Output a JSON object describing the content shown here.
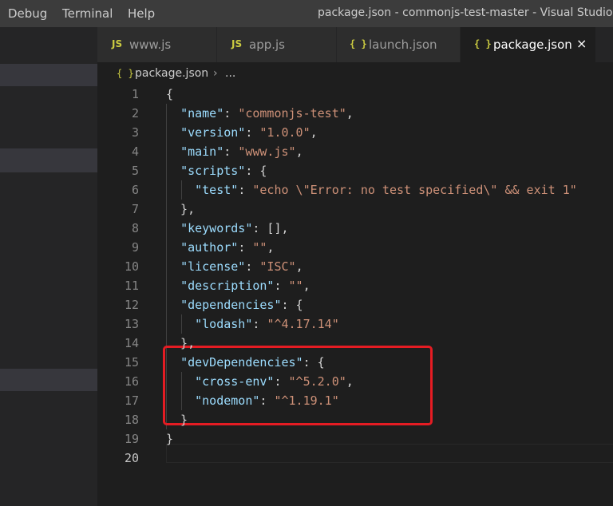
{
  "menu": [
    "Debug",
    "Terminal",
    "Help"
  ],
  "window_title": "package.json - commonjs-test-master - Visual Studio Co",
  "tabs": [
    {
      "label": "www.js",
      "icon": "JS",
      "active": false
    },
    {
      "label": "app.js",
      "icon": "JS",
      "active": false
    },
    {
      "label": "launch.json",
      "icon": "{ }",
      "active": false
    },
    {
      "label": "package.json",
      "icon": "{ }",
      "active": true,
      "close": "×"
    }
  ],
  "breadcrumb": {
    "icon": "{ }",
    "file": "package.json",
    "separator": "›",
    "more": "..."
  },
  "colors": {
    "highlight_border": "#e51c23",
    "key": "#9cdcfe",
    "string": "#ce9178"
  },
  "editor": {
    "line_numbers": [
      "1",
      "2",
      "3",
      "4",
      "5",
      "6",
      "7",
      "8",
      "9",
      "10",
      "11",
      "12",
      "13",
      "14",
      "15",
      "16",
      "17",
      "18",
      "19",
      "20"
    ],
    "lines": [
      "{",
      "  \"name\": \"commonjs-test\",",
      "  \"version\": \"1.0.0\",",
      "  \"main\": \"www.js\",",
      "  \"scripts\": {",
      "    \"test\": \"echo \\\"Error: no test specified\\\" && exit 1\"",
      "  },",
      "  \"keywords\": [],",
      "  \"author\": \"\",",
      "  \"license\": \"ISC\",",
      "  \"description\": \"\",",
      "  \"dependencies\": {",
      "    \"lodash\": \"^4.17.14\"",
      "  },",
      "  \"devDependencies\": {",
      "    \"cross-env\": \"^5.2.0\",",
      "    \"nodemon\": \"^1.19.1\"",
      "  }",
      "}",
      ""
    ]
  }
}
